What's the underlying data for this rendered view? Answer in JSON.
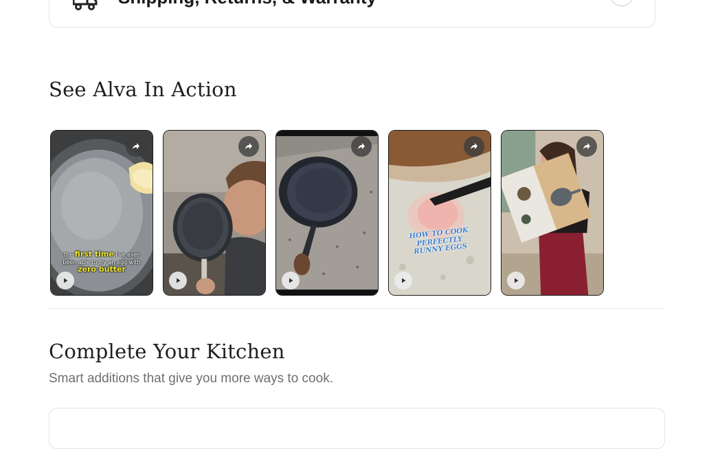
{
  "accordion": {
    "title": "Shipping, Returns, & Warranty",
    "icon": "truck-icon"
  },
  "action_section": {
    "heading": "See Alva In Action",
    "videos": [
      {
        "name": "video-egg-no-butter",
        "caption_parts": [
          "the",
          "first time",
          "I've ever",
          "been able to fry an egg with",
          "zero butter"
        ]
      },
      {
        "name": "video-man-holding-pans",
        "caption_parts": []
      },
      {
        "name": "video-pan-on-granite",
        "caption_parts": []
      },
      {
        "name": "video-runny-eggs",
        "caption_parts": [
          "HOW TO COOK PERFECTLY",
          "RUNNY EGGS"
        ]
      },
      {
        "name": "video-woman-with-box",
        "caption_parts": []
      }
    ],
    "share_icon": "share-icon",
    "play_icon": "play-icon"
  },
  "kitchen_section": {
    "heading": "Complete Your Kitchen",
    "subtitle": "Smart additions that give you more ways to cook."
  },
  "colors": {
    "text": "#1f1f1f",
    "muted": "#6e6e6e",
    "border": "#e4e4e4",
    "caption_yellow": "#f2ea2e",
    "caption_blue": "#3f7ec8"
  }
}
